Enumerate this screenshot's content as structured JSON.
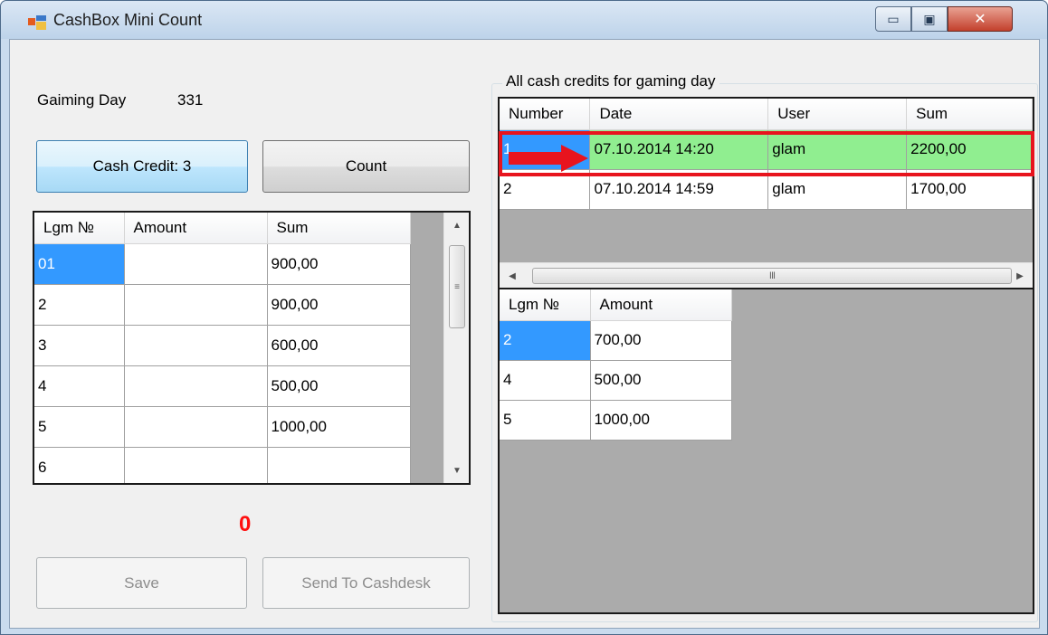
{
  "window": {
    "title": "CashBox Mini Count",
    "controls": {
      "minimize": "▭",
      "maximize": "▣",
      "close": "✕"
    }
  },
  "left": {
    "gaiming_label": "Gaiming Day",
    "gaiming_value": "331",
    "cash_credit_button": "Cash Credit: 3",
    "count_button": "Count",
    "grid": {
      "columns": [
        "Lgm №",
        "Amount",
        "Sum"
      ],
      "rows": [
        {
          "lgm": "01",
          "amount": "",
          "sum": "900,00"
        },
        {
          "lgm": "2",
          "amount": "",
          "sum": "900,00"
        },
        {
          "lgm": "3",
          "amount": "",
          "sum": "600,00"
        },
        {
          "lgm": "4",
          "amount": "",
          "sum": "500,00"
        },
        {
          "lgm": "5",
          "amount": "",
          "sum": "1000,00"
        },
        {
          "lgm": "6",
          "amount": "",
          "sum": ""
        }
      ]
    },
    "total": "0",
    "save_button": "Save",
    "send_button": "Send To Cashdesk"
  },
  "right": {
    "group_title": "All cash credits for gaming day",
    "credits_grid": {
      "columns": [
        "Number",
        "Date",
        "User",
        "Sum"
      ],
      "rows": [
        {
          "number": "1",
          "date": "07.10.2014 14:20",
          "user": "glam",
          "sum": "2200,00"
        },
        {
          "number": "2",
          "date": "07.10.2014 14:59",
          "user": "glam",
          "sum": "1700,00"
        }
      ],
      "scroll_grip": "III"
    },
    "detail_grid": {
      "columns": [
        "Lgm №",
        "Amount"
      ],
      "rows": [
        {
          "lgm": "2",
          "amount": "700,00"
        },
        {
          "lgm": "4",
          "amount": "500,00"
        },
        {
          "lgm": "5",
          "amount": "1000,00"
        }
      ]
    }
  },
  "colors": {
    "selected_row": "#90ee90",
    "selected_cell": "#3399ff",
    "highlight": "#e8141e",
    "total": "#ff1010"
  }
}
